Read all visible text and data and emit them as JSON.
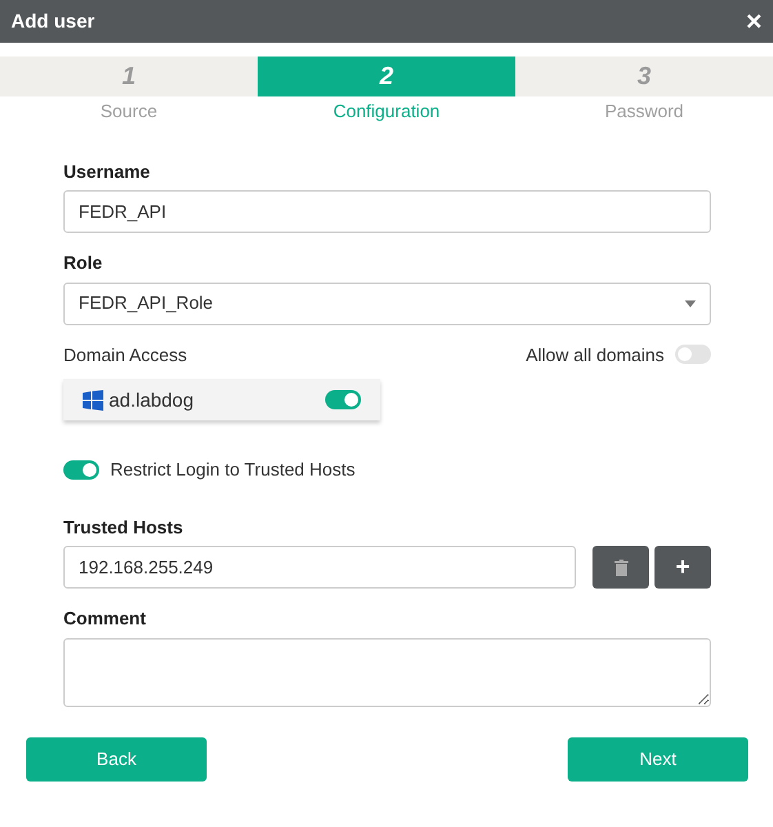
{
  "window": {
    "title": "Add user",
    "close": "×"
  },
  "steps": [
    {
      "number": "1",
      "label": "Source",
      "selected": false
    },
    {
      "number": "2",
      "label": "Configuration",
      "selected": true
    },
    {
      "number": "3",
      "label": "Password",
      "selected": false
    }
  ],
  "username": {
    "label": "Username",
    "value": "FEDR_API"
  },
  "role": {
    "label": "Role",
    "value": "FEDR_API_Role"
  },
  "domain_access": {
    "label": "Domain Access",
    "allow_all_label": "Allow all domains",
    "allow_all_on": false,
    "domains": [
      {
        "name": "ad.labdog",
        "on": true
      }
    ]
  },
  "restrict_login": {
    "label": "Restrict Login to Trusted Hosts",
    "on": true
  },
  "trusted_hosts": {
    "label": "Trusted Hosts",
    "value": "192.168.255.249",
    "add": "+"
  },
  "comment": {
    "label": "Comment"
  },
  "buttons": {
    "back": "Back",
    "next": "Next"
  }
}
